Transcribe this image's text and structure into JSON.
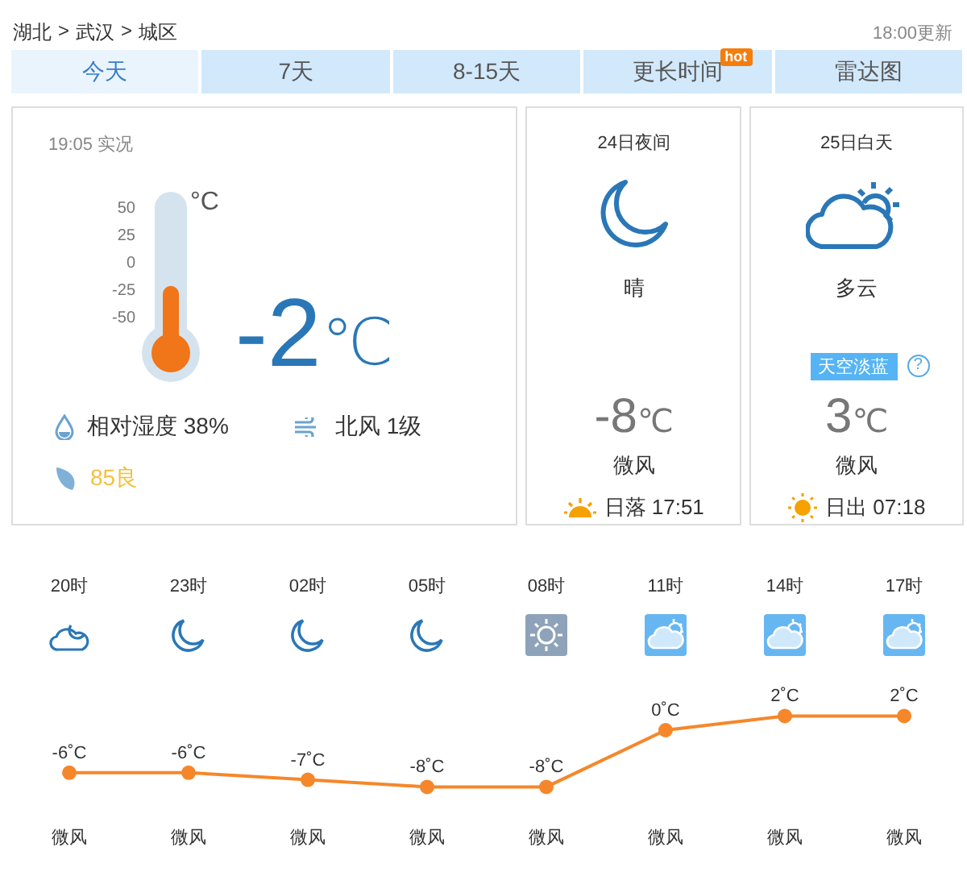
{
  "breadcrumb": [
    "湖北",
    "武汉",
    "城区"
  ],
  "separator": ">",
  "updated": "18:00更新",
  "tabs": [
    {
      "label": "今天",
      "selected": true
    },
    {
      "label": "7天",
      "selected": false
    },
    {
      "label": "8-15天",
      "selected": false
    },
    {
      "label": "更长时间",
      "selected": false,
      "badge": "hot"
    },
    {
      "label": "雷达图",
      "selected": false
    }
  ],
  "now": {
    "time": "19:05 实况",
    "scale": [
      "50",
      "25",
      "0",
      "-25",
      "-50"
    ],
    "scale_unit": "°C",
    "level": 0.48,
    "temp": "-2",
    "unit": "℃",
    "humidity": "相对湿度 38%",
    "wind": "北风 1级",
    "aqi": "85良"
  },
  "periods": [
    {
      "title": "24日夜间",
      "kind": "moon",
      "weather": "晴",
      "temp": "-8",
      "unit": "℃",
      "wind": "微风",
      "sun": {
        "kind": "sunset",
        "text": "日落 17:51"
      }
    },
    {
      "title": "25日白天",
      "kind": "cloud-sun",
      "weather": "多云",
      "badge": "天空淡蓝",
      "help": "?",
      "temp": "3",
      "unit": "℃",
      "wind": "微风",
      "sun": {
        "kind": "sunrise",
        "text": "日出 07:18"
      }
    }
  ],
  "hourly": {
    "items": [
      {
        "kind": "cloud-moon",
        "unit": "˚C",
        "wind": "微风"
      },
      {
        "kind": "moon",
        "unit": "˚C",
        "wind": "微风"
      },
      {
        "kind": "moon",
        "unit": "˚C",
        "wind": "微风"
      },
      {
        "kind": "moon",
        "unit": "˚C",
        "wind": "微风"
      },
      {
        "kind": "sunny-box",
        "unit": "˚C",
        "wind": "微风"
      },
      {
        "kind": "cloudy-box",
        "unit": "˚C",
        "wind": "微风"
      },
      {
        "kind": "cloudy-box",
        "unit": "˚C",
        "wind": "微风"
      },
      {
        "kind": "cloudy-box",
        "unit": "˚C",
        "wind": "微风"
      }
    ],
    "chart_data": {
      "type": "line",
      "categories": [
        "20时",
        "23时",
        "02时",
        "05时",
        "08时",
        "11时",
        "14时",
        "17时"
      ],
      "series": [
        {
          "color": "#f5872a",
          "marker": "circle",
          "values": [
            -6,
            -6,
            -7,
            -8,
            -8,
            0,
            2,
            2
          ]
        }
      ],
      "data_labels": true
    }
  }
}
